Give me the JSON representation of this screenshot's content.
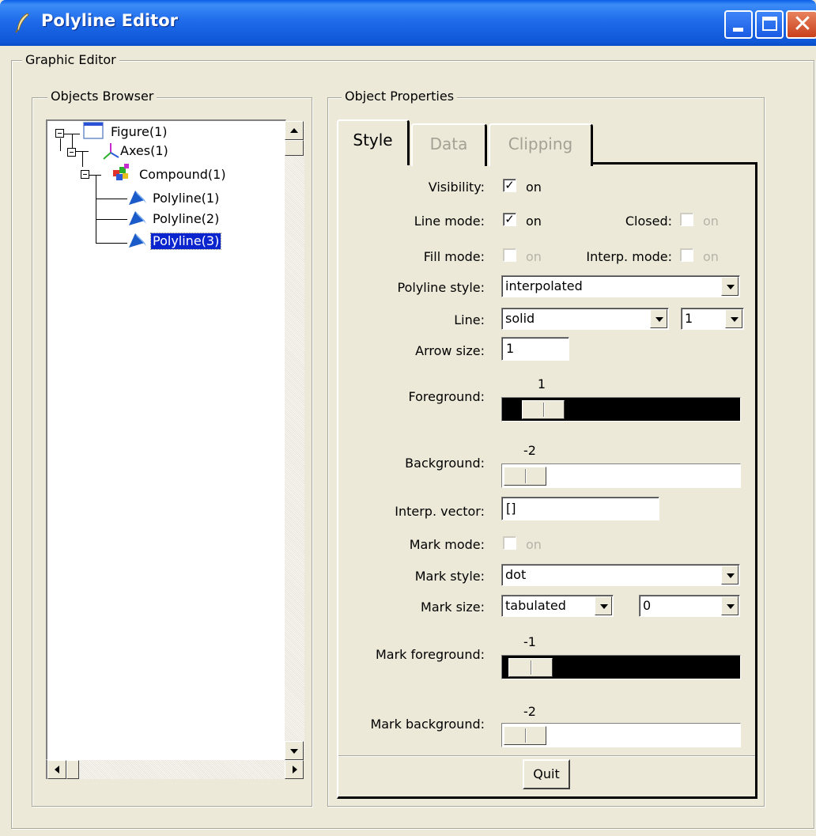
{
  "window": {
    "title": "Polyline Editor",
    "icon": "feather-icon",
    "controls": [
      "minimize-icon",
      "maximize-icon",
      "close-icon"
    ],
    "close_glyph": "✕"
  },
  "graphic_editor": {
    "label": "Graphic Editor"
  },
  "objects_browser": {
    "label": "Objects Browser",
    "tree": [
      {
        "label": "Figure(1)",
        "icon": "figure-window-icon",
        "depth": 0
      },
      {
        "label": "Axes(1)",
        "icon": "axes-icon",
        "depth": 1
      },
      {
        "label": "Compound(1)",
        "icon": "compound-icon",
        "depth": 2
      },
      {
        "label": "Polyline(1)",
        "icon": "polyline-icon",
        "depth": 3
      },
      {
        "label": "Polyline(2)",
        "icon": "polyline-icon",
        "depth": 3
      },
      {
        "label": "Polyline(3)",
        "icon": "polyline-icon",
        "depth": 3,
        "selected": true
      }
    ]
  },
  "object_properties": {
    "label": "Object Properties",
    "tabs": [
      {
        "label": "Style",
        "active": true
      },
      {
        "label": "Data",
        "active": false
      },
      {
        "label": "Clipping",
        "active": false
      }
    ],
    "visibility": {
      "label": "Visibility:",
      "checked": true,
      "text": "on"
    },
    "line_mode": {
      "label": "Line mode:",
      "checked": true,
      "text": "on"
    },
    "closed": {
      "label": "Closed:",
      "checked": false,
      "text": "on",
      "disabled": true
    },
    "fill_mode": {
      "label": "Fill mode:",
      "checked": false,
      "text": "on",
      "disabled": true
    },
    "interp_mode": {
      "label": "Interp. mode:",
      "checked": false,
      "text": "on",
      "disabled": true
    },
    "polyline_style": {
      "label": "Polyline style:",
      "value": "interpolated"
    },
    "line": {
      "label": "Line:",
      "style": "solid",
      "width": "1"
    },
    "arrow_size": {
      "label": "Arrow size:",
      "value": "1"
    },
    "foreground": {
      "label": "Foreground:",
      "value": "1"
    },
    "background": {
      "label": "Background:",
      "value": "-2"
    },
    "interp_vector": {
      "label": "Interp. vector:",
      "value": "[]"
    },
    "mark_mode": {
      "label": "Mark mode:",
      "checked": false,
      "text": "on",
      "disabled": true
    },
    "mark_style": {
      "label": "Mark style:",
      "value": "dot"
    },
    "mark_size": {
      "label": "Mark size:",
      "unit": "tabulated",
      "value": "0"
    },
    "mark_foreground": {
      "label": "Mark foreground:",
      "value": "-1"
    },
    "mark_background": {
      "label": "Mark background:",
      "value": "-2"
    },
    "quit_label": "Quit"
  },
  "colors": {
    "titlebar": "#0A5FE8",
    "window_bg": "#ECE9D8",
    "selection": "#0A24CE"
  }
}
